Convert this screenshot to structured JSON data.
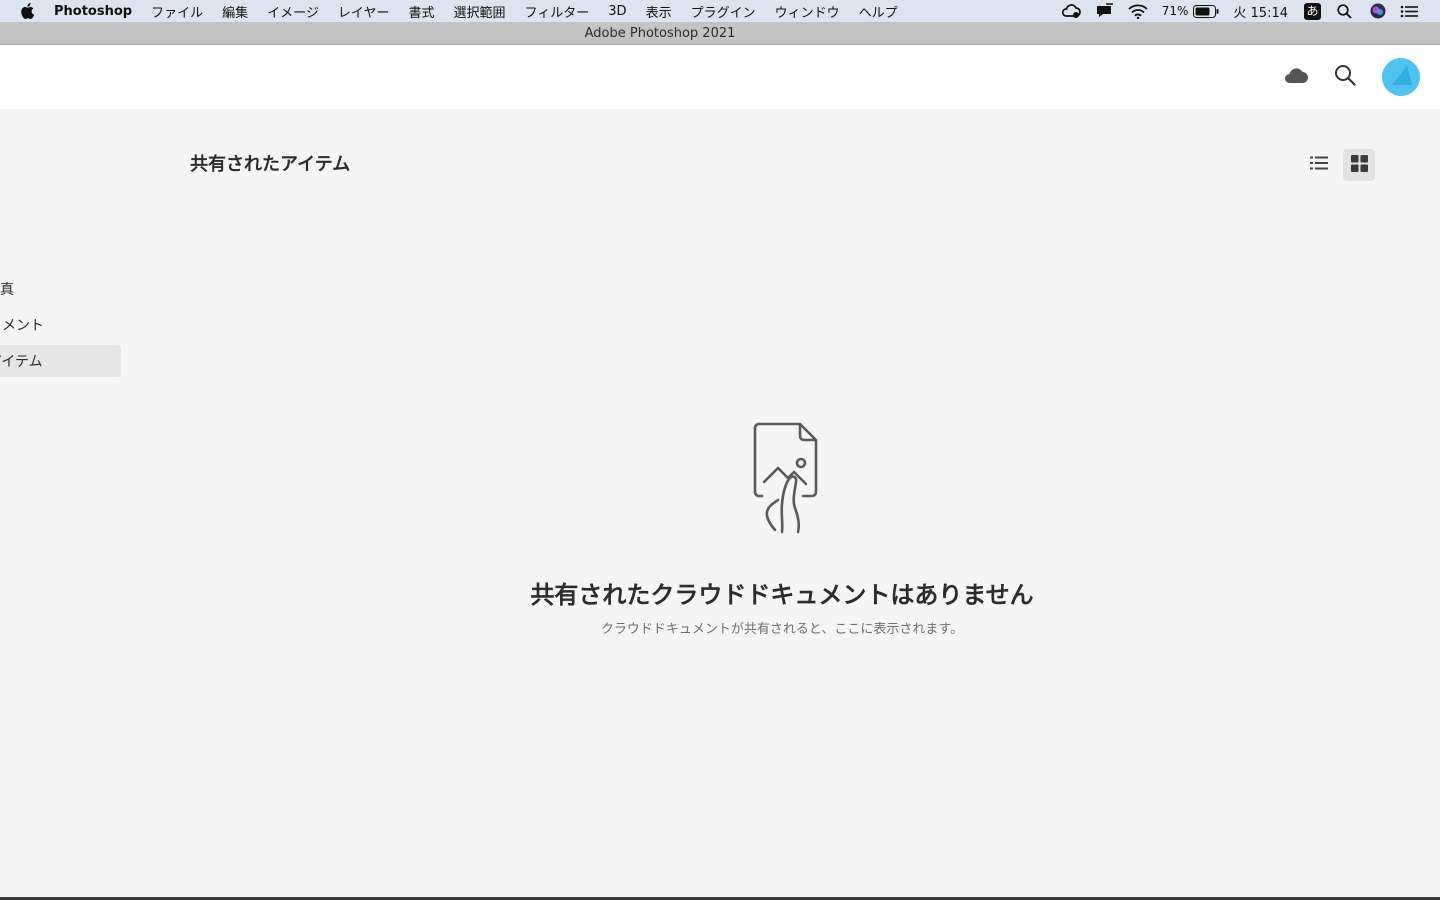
{
  "menubar": {
    "app_name": "Photoshop",
    "items": [
      "ファイル",
      "編集",
      "イメージ",
      "レイヤー",
      "書式",
      "選択範囲",
      "フィルター",
      "3D",
      "表示",
      "プラグイン",
      "ウィンドウ",
      "ヘルプ"
    ],
    "battery": "71%",
    "clock": "火 15:14",
    "input_method": "あ"
  },
  "window": {
    "title": "Adobe Photoshop 2021"
  },
  "sidebar": {
    "items": [
      {
        "label": "写真",
        "active": false
      },
      {
        "label": "ドキュメント",
        "active": false
      },
      {
        "label": "共有されたアイテム",
        "active": true
      }
    ]
  },
  "main": {
    "title": "共有されたアイテム",
    "empty_title": "共有されたクラウドドキュメントはありません",
    "empty_subtitle": "クラウドドキュメントが共有されると、ここに表示されます。"
  },
  "colors": {
    "avatar": "#4fc3f0",
    "background": "#f5f5f5",
    "header": "#ffffff",
    "menubar": "#dde4ef"
  },
  "icons": [
    "apple-icon",
    "creative-cloud-icon",
    "notification-icon",
    "wifi-icon",
    "battery-icon",
    "spotlight-icon",
    "siri-icon",
    "control-center-icon",
    "cloud-icon",
    "search-icon",
    "list-view-icon",
    "grid-view-icon",
    "shared-document-icon"
  ]
}
